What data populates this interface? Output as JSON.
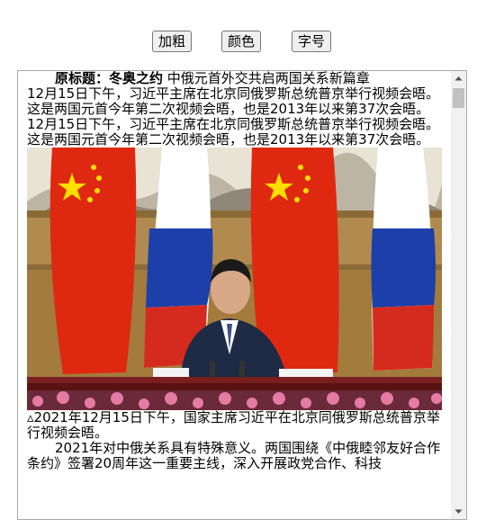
{
  "toolbar": {
    "bold_label": "加粗",
    "color_label": "颜色",
    "size_label": "字号"
  },
  "article": {
    "source_label": "原标题：冬奥之约",
    "source_title": " 中俄元首外交共启两国关系新篇章",
    "para1": "12月15日下午，习近平主席在北京同俄罗斯总统普京举行视频会晤。这是两国元首今年第二次视频会晤，也是2013年以来第37次会晤。",
    "para2": "12月15日下午，习近平主席在北京同俄罗斯总统普京举行视频会晤。这是两国元首今年第二次视频会晤，也是2013年以来第37次会晤。",
    "caption": "▵2021年12月15日下午，国家主席习近平在北京同俄罗斯总统普京举行视频会晤。",
    "para3": "2021年对中俄关系具有特殊意义。两国围绕《中俄睦邻友好合作条约》签署20周年这一重要主线，深入开展政党合作、科技"
  }
}
